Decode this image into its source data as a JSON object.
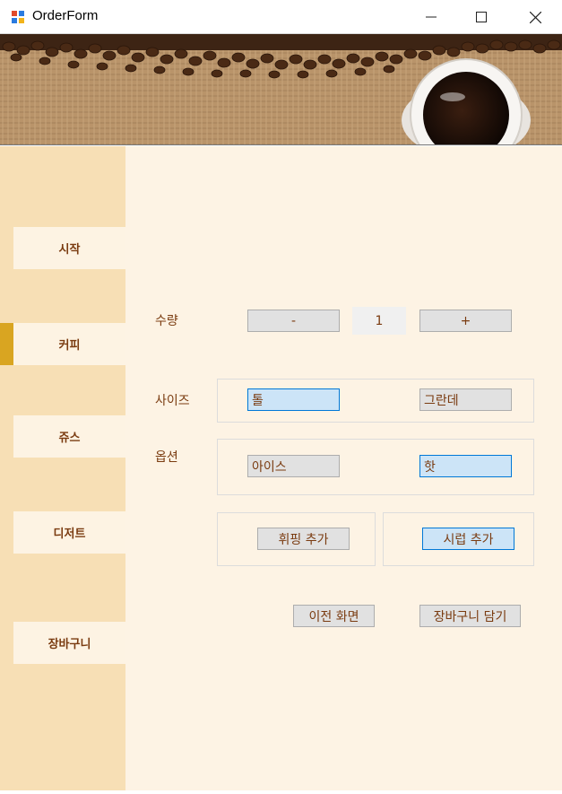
{
  "window": {
    "title": "OrderForm",
    "minimize_icon": "minimize-icon",
    "maximize_icon": "maximize-icon",
    "close_icon": "close-icon"
  },
  "sidebar": {
    "items": [
      {
        "label": "시작"
      },
      {
        "label": "커피"
      },
      {
        "label": "쥬스"
      },
      {
        "label": "디저트"
      },
      {
        "label": "장바구니"
      }
    ],
    "selected": "커피"
  },
  "form": {
    "quantity_label": "수량",
    "minus_label": "-",
    "quantity_value": "1",
    "plus_label": "+",
    "size_label": "사이즈",
    "size_options": [
      "톨",
      "그란데"
    ],
    "size_selected": "톨",
    "option_label": "옵션",
    "temp_options": [
      "아이스",
      "핫"
    ],
    "temp_selected": "핫",
    "whipping_label": "휘핑 추가",
    "syrup_label": "시럽 추가",
    "prev_label": "이전 화면",
    "cart_label": "장바구니 담기"
  },
  "colors": {
    "sidebar_bg": "#f7dfb5",
    "main_bg": "#fdf3e4",
    "accent": "#d9a521",
    "text_brown": "#7a3b10",
    "selected_bg": "#cce4f7",
    "selected_border": "#0078d7"
  }
}
